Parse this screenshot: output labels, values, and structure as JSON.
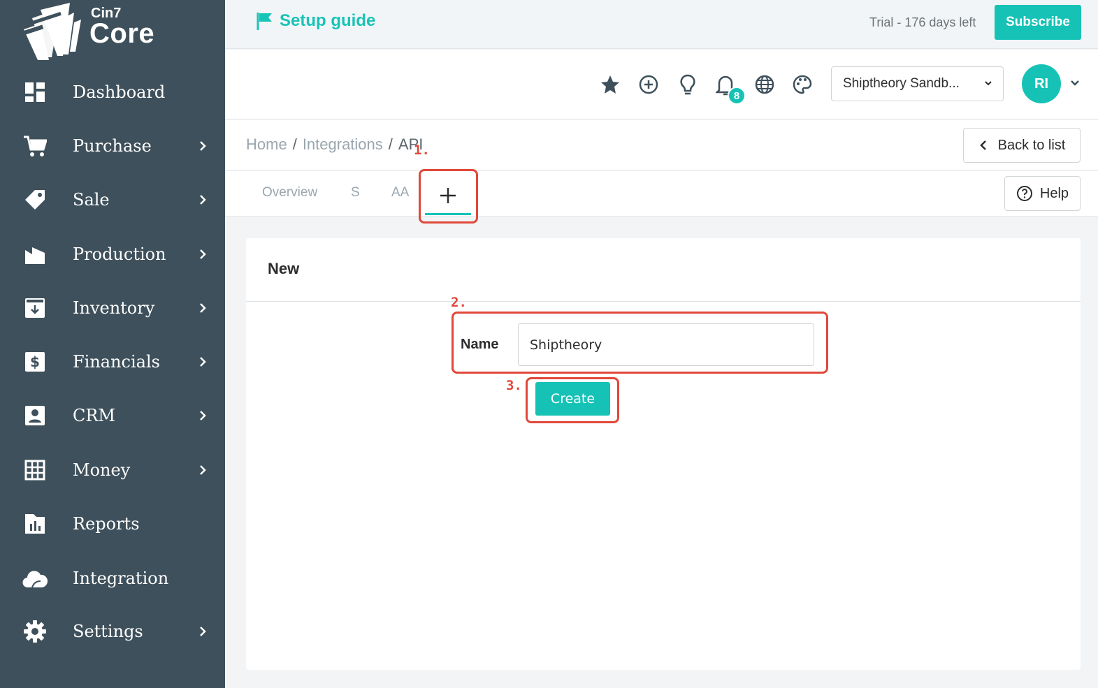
{
  "brand": {
    "top": "Cin7",
    "bottom": "Core"
  },
  "sidebar": {
    "items": [
      {
        "label": "Dashboard",
        "icon": "dashboard-icon",
        "has_submenu": false
      },
      {
        "label": "Purchase",
        "icon": "cart-icon",
        "has_submenu": true
      },
      {
        "label": "Sale",
        "icon": "tag-icon",
        "has_submenu": true
      },
      {
        "label": "Production",
        "icon": "factory-icon",
        "has_submenu": true
      },
      {
        "label": "Inventory",
        "icon": "inventory-icon",
        "has_submenu": true
      },
      {
        "label": "Financials",
        "icon": "dollar-icon",
        "has_submenu": true
      },
      {
        "label": "CRM",
        "icon": "contact-card-icon",
        "has_submenu": true
      },
      {
        "label": "Money",
        "icon": "grid-calculator-icon",
        "has_submenu": true
      },
      {
        "label": "Reports",
        "icon": "bar-chart-icon",
        "has_submenu": false
      },
      {
        "label": "Integration",
        "icon": "cloud-icon",
        "has_submenu": false
      },
      {
        "label": "Settings",
        "icon": "gear-icon",
        "has_submenu": true
      }
    ]
  },
  "topbar": {
    "setup_guide": "Setup guide",
    "trial": "Trial - 176 days left",
    "subscribe": "Subscribe"
  },
  "header": {
    "icons": [
      "star-icon",
      "add-circle-icon",
      "lightbulb-icon",
      "bell-icon",
      "globe-icon",
      "palette-icon"
    ],
    "notification_count": "8",
    "company": "Shiptheory Sandb...",
    "avatar_initials": "RI"
  },
  "breadcrumb": {
    "home": "Home",
    "integrations": "Integrations",
    "current": "API",
    "back_label": "Back to list"
  },
  "tabs": {
    "items": [
      "Overview",
      "S",
      "AA"
    ],
    "help_label": "Help"
  },
  "form": {
    "title": "New",
    "name_label": "Name",
    "name_value": "Shiptheory",
    "create_label": "Create"
  },
  "annotations": {
    "step1": "1.",
    "step2": "2.",
    "step3": "3."
  },
  "colors": {
    "sidebar": "#3e505b",
    "accent": "#16c2b6",
    "annotation": "#e0483a"
  }
}
